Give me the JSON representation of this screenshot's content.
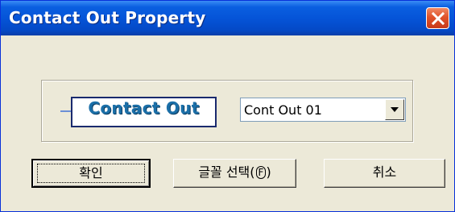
{
  "window": {
    "title": "Contact Out Property",
    "close_icon": "close-icon"
  },
  "preview": {
    "text": "Contact Out"
  },
  "style_select": {
    "value": "Cont Out 01",
    "arrow_icon": "chevron-down-icon"
  },
  "buttons": {
    "ok_label": "확인",
    "font_label": "글꼴 선택",
    "font_mnemonic": "F",
    "font_paren_open": "(",
    "font_paren_close": ")",
    "cancel_label": "취소"
  },
  "colors": {
    "title_bar": "#0554d8",
    "close_button": "#e0532b",
    "dialog_face": "#ece9d8",
    "preview_text": "#1b6fa8",
    "preview_border": "#1a2a6e"
  }
}
